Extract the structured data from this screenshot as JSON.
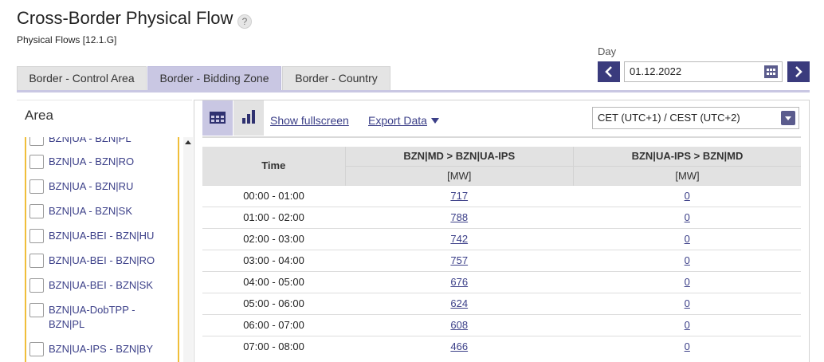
{
  "header": {
    "title": "Cross-Border Physical Flow",
    "help": "?",
    "subtitle": "Physical Flows [12.1.G]"
  },
  "tabs": [
    {
      "label": "Border - Control Area",
      "active": false
    },
    {
      "label": "Border - Bidding Zone",
      "active": true
    },
    {
      "label": "Border - Country",
      "active": false
    }
  ],
  "day": {
    "label": "Day",
    "value": "01.12.2022"
  },
  "area": {
    "title": "Area",
    "items": [
      "BZN|UA - BZN|PL",
      "BZN|UA - BZN|RO",
      "BZN|UA - BZN|RU",
      "BZN|UA - BZN|SK",
      "BZN|UA-BEI - BZN|HU",
      "BZN|UA-BEI - BZN|RO",
      "BZN|UA-BEI - BZN|SK",
      "BZN|UA-DobTPP - BZN|PL",
      "BZN|UA-IPS - BZN|BY"
    ]
  },
  "toolbar": {
    "fullscreen_label": "Show fullscreen",
    "export_label": "Export Data",
    "timezone": "CET (UTC+1) / CEST (UTC+2)"
  },
  "table": {
    "time_header": "Time",
    "columns": [
      {
        "name": "BZN|MD > BZN|UA-IPS",
        "unit": "[MW]"
      },
      {
        "name": "BZN|UA-IPS > BZN|MD",
        "unit": "[MW]"
      }
    ],
    "rows": [
      {
        "time": "00:00 - 01:00",
        "a": "717",
        "b": "0"
      },
      {
        "time": "01:00 - 02:00",
        "a": "788",
        "b": "0"
      },
      {
        "time": "02:00 - 03:00",
        "a": "742",
        "b": "0"
      },
      {
        "time": "03:00 - 04:00",
        "a": "757",
        "b": "0"
      },
      {
        "time": "04:00 - 05:00",
        "a": "676",
        "b": "0"
      },
      {
        "time": "05:00 - 06:00",
        "a": "624",
        "b": "0"
      },
      {
        "time": "06:00 - 07:00",
        "a": "608",
        "b": "0"
      },
      {
        "time": "07:00 - 08:00",
        "a": "466",
        "b": "0"
      }
    ]
  },
  "colors": {
    "accent": "#3a3b7d",
    "tab_active": "#c9c7e3",
    "link": "#3b3f88",
    "area_border": "#f0be3a"
  }
}
